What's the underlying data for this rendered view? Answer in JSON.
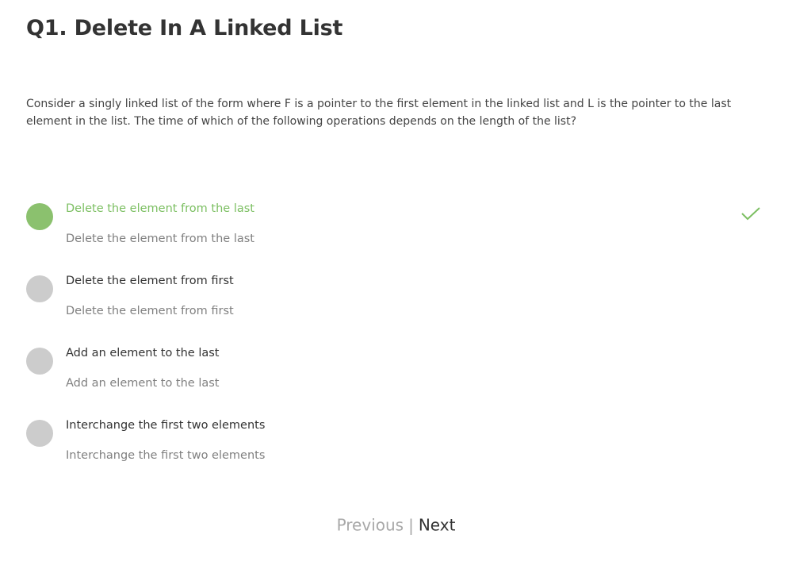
{
  "question": {
    "title": "Q1. Delete In A Linked List",
    "text": "Consider a singly linked list of the form where F is a pointer to the first element in the linked list and L is the pointer to the last element in the list. The time of which of the following operations depends on the length of the list?"
  },
  "options": [
    {
      "label": "Delete the element from the last",
      "sub": "Delete the element from the last",
      "selected": true
    },
    {
      "label": "Delete the element from first",
      "sub": "Delete the element from first",
      "selected": false
    },
    {
      "label": "Add an element to the last",
      "sub": "Add an element to the last",
      "selected": false
    },
    {
      "label": "Interchange the first two elements",
      "sub": "Interchange the first two elements",
      "selected": false
    }
  ],
  "nav": {
    "previous": "Previous",
    "separator": "|",
    "next": "Next"
  },
  "colors": {
    "selected": "#8bc16e",
    "unselected": "#cccccc",
    "check": "#7cbf62"
  }
}
